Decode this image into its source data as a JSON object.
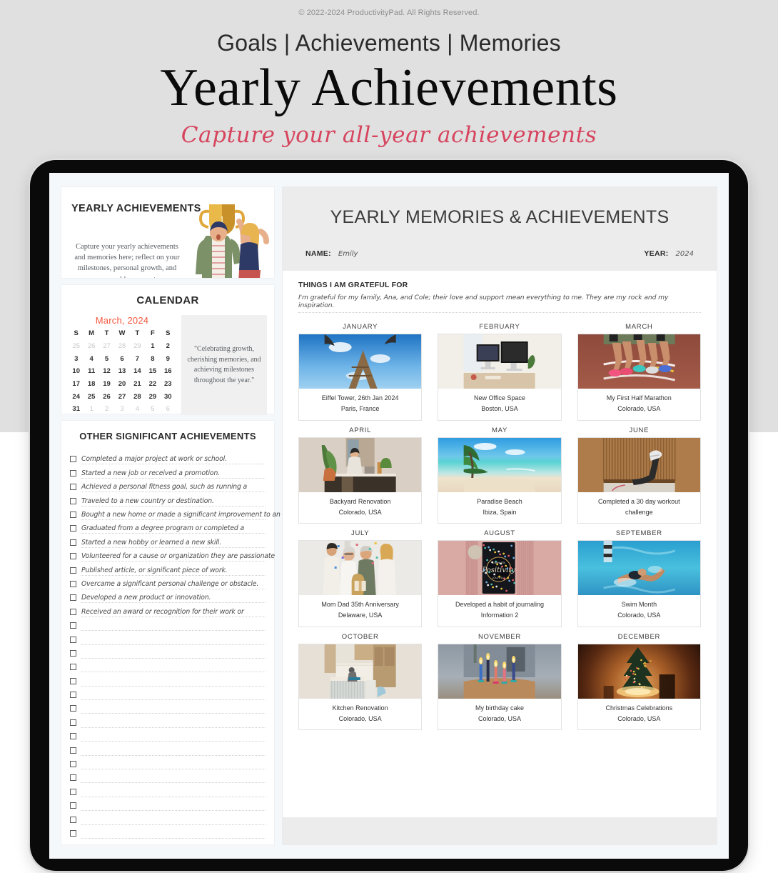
{
  "hero": {
    "copyright": "© 2022-2024 ProductivityPad. All Rights Reserved.",
    "kicker": "Goals | Achievements | Memories",
    "title": "Yearly Achievements",
    "subtitle": "Capture your all-year achievements",
    "accent_color": "#d6445e"
  },
  "left": {
    "intro": {
      "title": "YEARLY ACHIEVEMENTS",
      "body": "Capture your yearly achievements and memories here; reflect on your milestones, personal growth, and memorable moments",
      "illustration": "trophy-celebration-illustration"
    },
    "calendar": {
      "heading": "CALENDAR",
      "month_label": "March, 2024",
      "month_color": "#f4563c",
      "weekdays": [
        "S",
        "M",
        "T",
        "W",
        "T",
        "F",
        "S"
      ],
      "weeks": [
        [
          {
            "d": "25",
            "o": true
          },
          {
            "d": "26",
            "o": true
          },
          {
            "d": "27",
            "o": true
          },
          {
            "d": "28",
            "o": true
          },
          {
            "d": "29",
            "o": true
          },
          {
            "d": "1",
            "o": false
          },
          {
            "d": "2",
            "o": false
          }
        ],
        [
          {
            "d": "3",
            "o": false
          },
          {
            "d": "4",
            "o": false
          },
          {
            "d": "5",
            "o": false
          },
          {
            "d": "6",
            "o": false
          },
          {
            "d": "7",
            "o": false
          },
          {
            "d": "8",
            "o": false
          },
          {
            "d": "9",
            "o": false
          }
        ],
        [
          {
            "d": "10",
            "o": false
          },
          {
            "d": "11",
            "o": false
          },
          {
            "d": "12",
            "o": false
          },
          {
            "d": "13",
            "o": false
          },
          {
            "d": "14",
            "o": false
          },
          {
            "d": "15",
            "o": false
          },
          {
            "d": "16",
            "o": false
          }
        ],
        [
          {
            "d": "17",
            "o": false
          },
          {
            "d": "18",
            "o": false
          },
          {
            "d": "19",
            "o": false
          },
          {
            "d": "20",
            "o": false
          },
          {
            "d": "21",
            "o": false
          },
          {
            "d": "22",
            "o": false
          },
          {
            "d": "23",
            "o": false
          }
        ],
        [
          {
            "d": "24",
            "o": false
          },
          {
            "d": "25",
            "o": false
          },
          {
            "d": "26",
            "o": false
          },
          {
            "d": "27",
            "o": false
          },
          {
            "d": "28",
            "o": false
          },
          {
            "d": "29",
            "o": false
          },
          {
            "d": "30",
            "o": false
          }
        ],
        [
          {
            "d": "31",
            "o": false
          },
          {
            "d": "1",
            "o": true
          },
          {
            "d": "2",
            "o": true
          },
          {
            "d": "3",
            "o": true
          },
          {
            "d": "4",
            "o": true
          },
          {
            "d": "5",
            "o": true
          },
          {
            "d": "6",
            "o": true
          }
        ]
      ],
      "quote": "\"Celebrating growth, cherishing memories, and achieving milestones throughout the year.\""
    },
    "other_achievements": {
      "heading": "OTHER SIGNIFICANT ACHIEVEMENTS",
      "items": [
        "Completed a major project at work or school.",
        "Started a new job or received a promotion.",
        "Achieved a personal fitness goal, such as running a",
        "Traveled to a new country or destination.",
        "Bought a new home or made a significant improvement to an",
        "Graduated from a degree program or completed a",
        "Started a new hobby or learned a new skill.",
        "Volunteered for a cause or organization they are passionate",
        "Published article, or significant piece of work.",
        "Overcame a significant personal challenge or obstacle.",
        "Developed a new product or innovation.",
        "Received an award or recognition for their work or",
        "",
        "",
        "",
        "",
        "",
        "",
        "",
        "",
        "",
        "",
        "",
        "",
        "",
        "",
        "",
        ""
      ]
    }
  },
  "right": {
    "title": "YEARLY MEMORIES & ACHIEVEMENTS",
    "name_label": "NAME:",
    "name_value": "Emily",
    "year_label": "YEAR:",
    "year_value": "2024",
    "grateful_title": "THINGS I AM GRATEFUL FOR",
    "grateful_text": "I'm grateful for my family, Ana, and Cole; their love and support mean everything to me. They are my rock and my inspiration.",
    "months": [
      {
        "name": "JANUARY",
        "line1": "Eiffel Tower, 26th Jan 2024",
        "line2": "Paris, France",
        "photo": "eiffel-tower-photo"
      },
      {
        "name": "FEBRUARY",
        "line1": "New Office Space",
        "line2": "Boston, USA",
        "photo": "office-desk-monitors-photo"
      },
      {
        "name": "MARCH",
        "line1": "My First Half Marathon",
        "line2": "Colorado, USA",
        "photo": "runners-track-photo"
      },
      {
        "name": "APRIL",
        "line1": "Backyard Renovation",
        "line2": "Colorado, USA",
        "photo": "person-at-desk-plants-photo"
      },
      {
        "name": "MAY",
        "line1": "Paradise Beach",
        "line2": "Ibiza, Spain",
        "photo": "tropical-beach-photo"
      },
      {
        "name": "JUNE",
        "line1": "Completed a 30 day workout",
        "line2": "challenge",
        "photo": "workout-legs-up-photo"
      },
      {
        "name": "JULY",
        "line1": "Mom Dad 35th Anniversary",
        "line2": "Delaware, USA",
        "photo": "family-celebration-photo"
      },
      {
        "name": "AUGUST",
        "line1": "Developed a habit of journaling",
        "line2": "Information 2",
        "photo": "positivity-journal-photo"
      },
      {
        "name": "SEPTEMBER",
        "line1": "Swim Month",
        "line2": "Colorado, USA",
        "photo": "swimmer-pool-photo"
      },
      {
        "name": "OCTOBER",
        "line1": "Kitchen Renovation",
        "line2": "Colorado, USA",
        "photo": "kitchen-interior-photo"
      },
      {
        "name": "NOVEMBER",
        "line1": "My birthday cake",
        "line2": "Colorado, USA",
        "photo": "birthday-candles-photo"
      },
      {
        "name": "DECEMBER",
        "line1": "Christmas Celebrations",
        "line2": "Colorado, USA",
        "photo": "christmas-tree-photo"
      }
    ]
  }
}
